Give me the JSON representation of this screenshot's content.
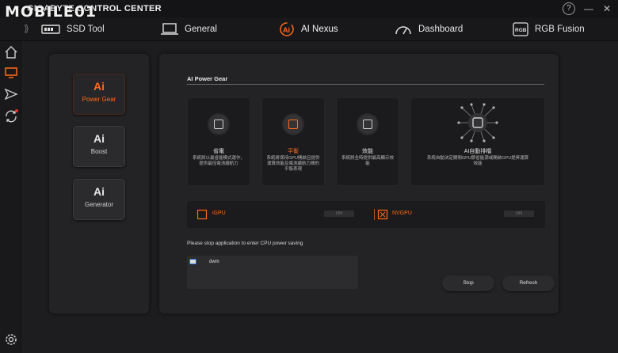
{
  "watermark": "MOBILE01",
  "app": {
    "title": "GIGABYTE CONTROL CENTER"
  },
  "window": {
    "help_icon": "?",
    "minimize_icon": "—",
    "close_icon": "✕"
  },
  "topnav": {
    "collapse_icon": "⟫",
    "items": [
      {
        "label": "SSD Tool",
        "icon": "ssd-icon"
      },
      {
        "label": "General",
        "icon": "laptop-icon"
      },
      {
        "label": "AI Nexus",
        "icon": "ai-nexus-icon"
      },
      {
        "label": "Dashboard",
        "icon": "gauge-icon"
      },
      {
        "label": "RGB Fusion",
        "icon": "rgb-icon"
      }
    ]
  },
  "rail": {
    "icons": [
      "home-icon",
      "monitor-icon",
      "send-icon",
      "sync-icon",
      "settings-icon"
    ]
  },
  "modes": [
    {
      "ai": "Ai",
      "label": "Power Gear",
      "active": true
    },
    {
      "ai": "Ai",
      "label": "Boost",
      "active": false
    },
    {
      "ai": "Ai",
      "label": "Generator",
      "active": false
    }
  ],
  "main": {
    "section_title": "AI Power Gear",
    "cards": [
      {
        "name": "省電",
        "desc": "系統將以最省能模式運作，提供最佳電池續航力"
      },
      {
        "name": "平衡",
        "desc": "系統將保持GPU開啟且提供運算效能及電池續航力間的平衡表現"
      },
      {
        "name": "效能",
        "desc": "系統將全時提供最高顯示效能"
      },
      {
        "name": "AI自動排檔",
        "desc": "系統自動決定關閉GPU節省能源或開啟GPU提昇運算效能"
      }
    ],
    "gpus": [
      {
        "label": "iGPU",
        "state": "ON"
      },
      {
        "label": "NVGPU",
        "state": "ON"
      }
    ],
    "notice": "Please stop application to enter CPU power saving",
    "apps": [
      {
        "name": "dwm"
      }
    ],
    "buttons": {
      "stop": "Stop",
      "refresh": "Refresh"
    }
  },
  "colors": {
    "accent": "#ff6a1a",
    "background": "#1d1d1f",
    "panel": "#232325"
  }
}
